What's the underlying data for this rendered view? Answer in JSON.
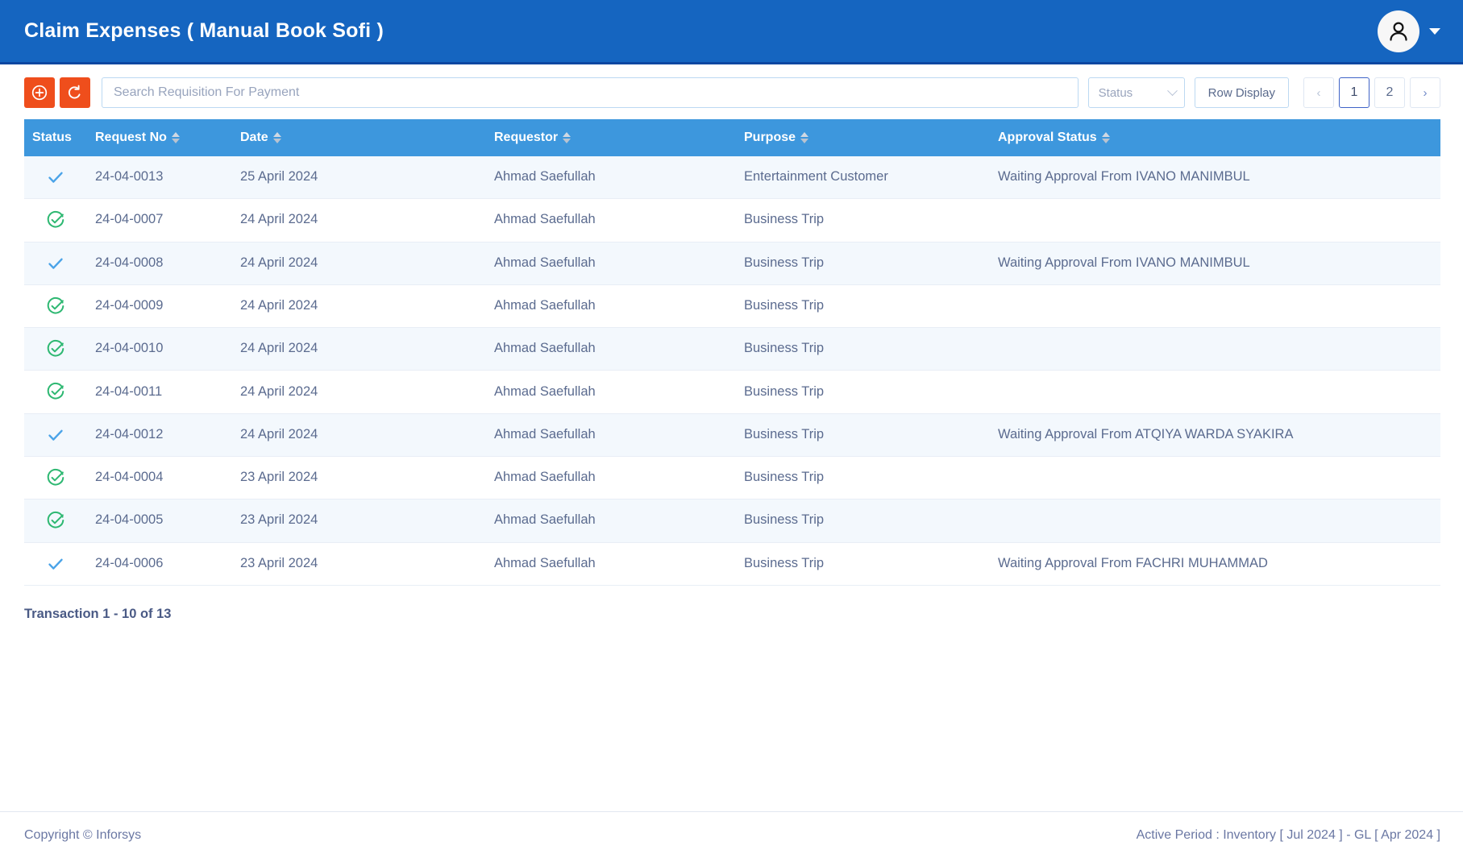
{
  "header": {
    "title": "Claim Expenses ( Manual Book Sofi )",
    "avatar_icon": "user-avatar-icon",
    "caret_icon": "chevron-down-icon"
  },
  "toolbar": {
    "add_icon": "plus-circle-icon",
    "refresh_icon": "refresh-undo-icon",
    "search_placeholder": "Search Requisition For Payment",
    "search_value": "",
    "status_label": "Status",
    "row_display_label": "Row Display",
    "pagination": {
      "prev_label": "‹",
      "next_label": "›",
      "pages": [
        "1",
        "2"
      ],
      "active_page": "1"
    }
  },
  "table": {
    "columns": [
      {
        "label": "Status",
        "sortable": false
      },
      {
        "label": "Request No",
        "sortable": true
      },
      {
        "label": "Date",
        "sortable": true
      },
      {
        "label": "Requestor",
        "sortable": true
      },
      {
        "label": "Purpose",
        "sortable": true
      },
      {
        "label": "Approval Status",
        "sortable": true
      }
    ],
    "rows": [
      {
        "status_icon": "check-icon",
        "request_no": "24-04-0013",
        "date": "25 April 2024",
        "requestor": "Ahmad Saefullah",
        "purpose": "Entertainment Customer",
        "approval_status": "Waiting Approval From IVANO MANIMBUL"
      },
      {
        "status_icon": "check-circle-icon",
        "request_no": "24-04-0007",
        "date": "24 April 2024",
        "requestor": "Ahmad Saefullah",
        "purpose": "Business Trip",
        "approval_status": ""
      },
      {
        "status_icon": "check-icon",
        "request_no": "24-04-0008",
        "date": "24 April 2024",
        "requestor": "Ahmad Saefullah",
        "purpose": "Business Trip",
        "approval_status": "Waiting Approval From IVANO MANIMBUL"
      },
      {
        "status_icon": "check-circle-icon",
        "request_no": "24-04-0009",
        "date": "24 April 2024",
        "requestor": "Ahmad Saefullah",
        "purpose": "Business Trip",
        "approval_status": ""
      },
      {
        "status_icon": "check-circle-icon",
        "request_no": "24-04-0010",
        "date": "24 April 2024",
        "requestor": "Ahmad Saefullah",
        "purpose": "Business Trip",
        "approval_status": ""
      },
      {
        "status_icon": "check-circle-icon",
        "request_no": "24-04-0011",
        "date": "24 April 2024",
        "requestor": "Ahmad Saefullah",
        "purpose": "Business Trip",
        "approval_status": ""
      },
      {
        "status_icon": "check-icon",
        "request_no": "24-04-0012",
        "date": "24 April 2024",
        "requestor": "Ahmad Saefullah",
        "purpose": "Business Trip",
        "approval_status": "Waiting Approval From ATQIYA WARDA SYAKIRA"
      },
      {
        "status_icon": "check-circle-icon",
        "request_no": "24-04-0004",
        "date": "23 April 2024",
        "requestor": "Ahmad Saefullah",
        "purpose": "Business Trip",
        "approval_status": ""
      },
      {
        "status_icon": "check-circle-icon",
        "request_no": "24-04-0005",
        "date": "23 April 2024",
        "requestor": "Ahmad Saefullah",
        "purpose": "Business Trip",
        "approval_status": ""
      },
      {
        "status_icon": "check-icon",
        "request_no": "24-04-0006",
        "date": "23 April 2024",
        "requestor": "Ahmad Saefullah",
        "purpose": "Business Trip",
        "approval_status": "Waiting Approval From FACHRI MUHAMMAD"
      }
    ]
  },
  "transaction_count": "Transaction 1 - 10 of 13",
  "footer": {
    "copyright": "Copyright © Inforsys",
    "active_period": "Active Period  :  Inventory [ Jul 2024 ]  -  GL [ Apr 2024 ]"
  },
  "colors": {
    "header_blue": "#1565c0",
    "table_header_blue": "#3d97dd",
    "accent_orange": "#ef4e1c",
    "check_blue": "#4aa3e8",
    "check_green": "#2eb872",
    "text_muted": "#5b6b8f"
  }
}
